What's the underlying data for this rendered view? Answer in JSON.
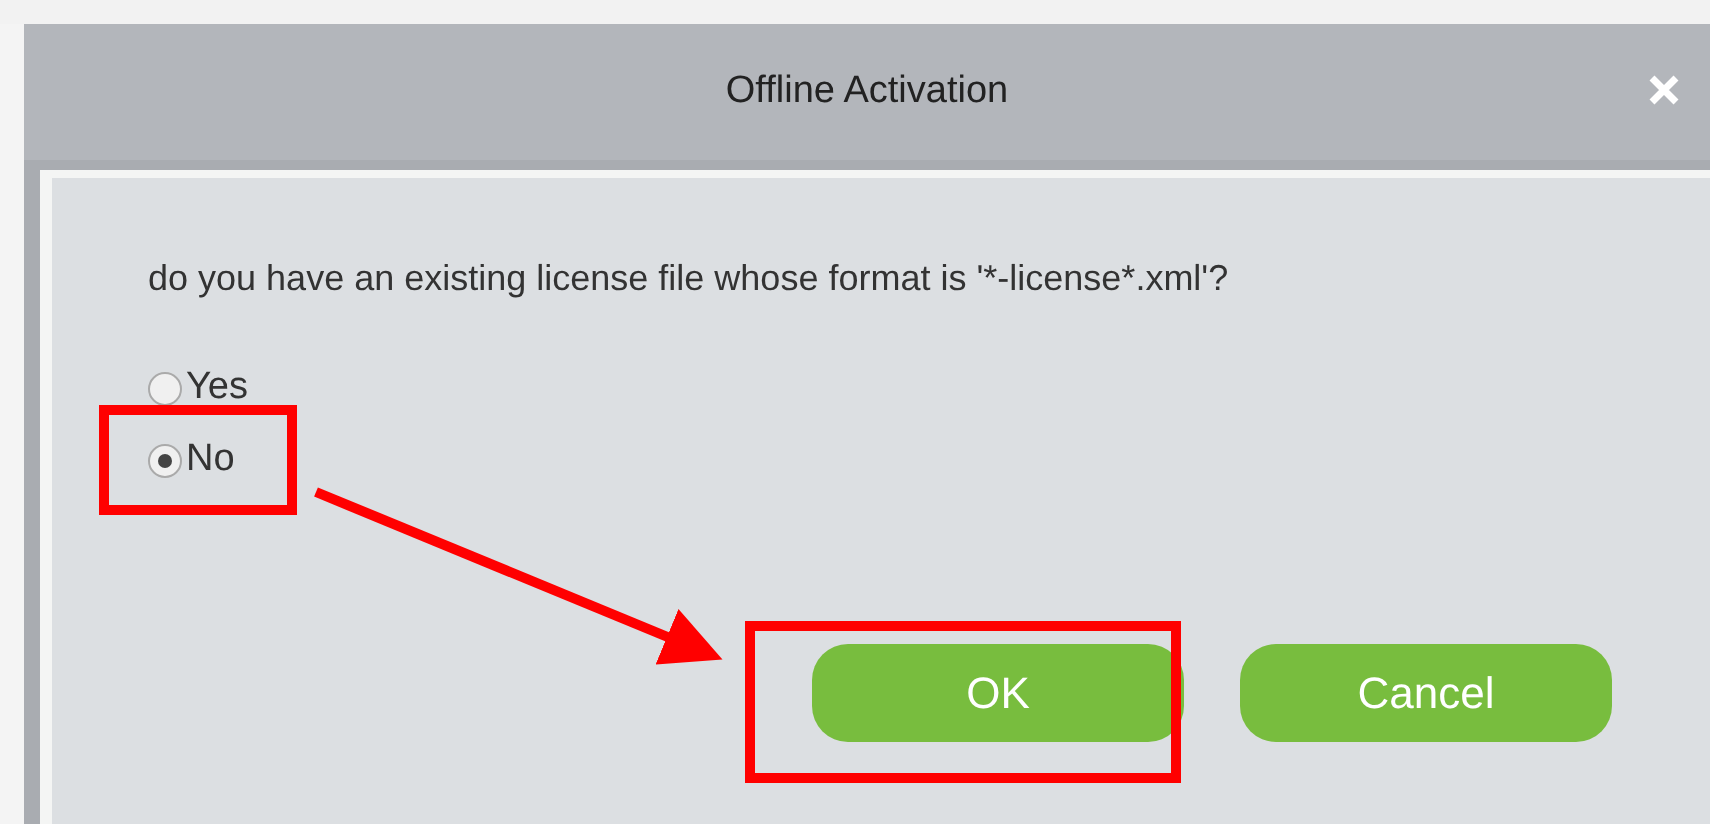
{
  "dialog": {
    "title": "Offline Activation",
    "question": "do you have an existing license file whose format is '*-license*.xml'?",
    "options": [
      {
        "label": "Yes",
        "selected": false
      },
      {
        "label": "No",
        "selected": true
      }
    ],
    "buttons": [
      {
        "label": "OK"
      },
      {
        "label": "Cancel"
      }
    ]
  }
}
